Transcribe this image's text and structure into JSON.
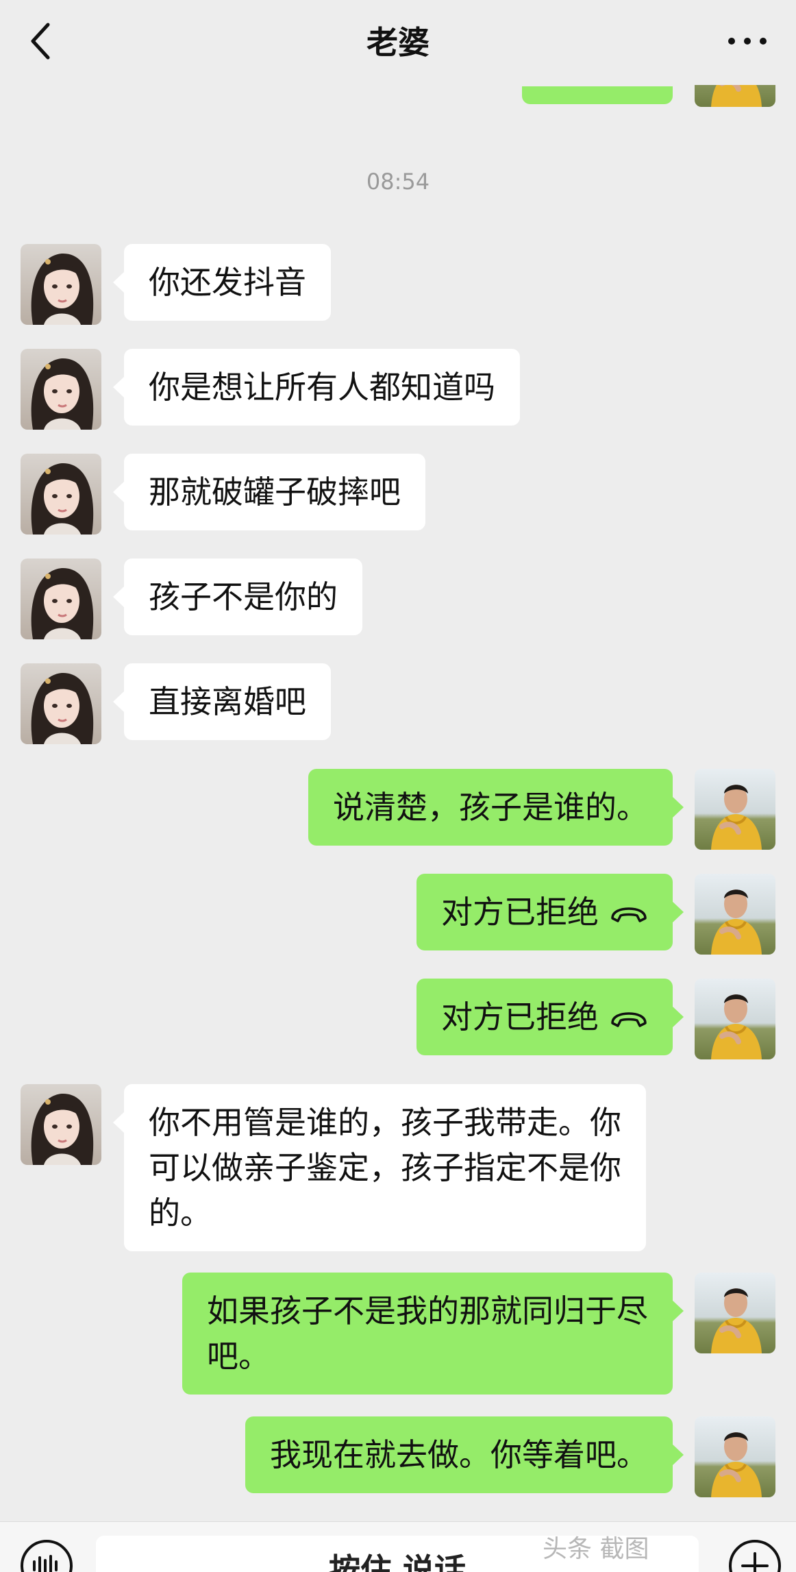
{
  "header": {
    "title": "老婆"
  },
  "timestamp": "08:54",
  "messages": [
    {
      "side": "in",
      "text": "你还发抖音"
    },
    {
      "side": "in",
      "text": "你是想让所有人都知道吗"
    },
    {
      "side": "in",
      "text": "那就破罐子破摔吧"
    },
    {
      "side": "in",
      "text": "孩子不是你的"
    },
    {
      "side": "in",
      "text": "直接离婚吧"
    },
    {
      "side": "out",
      "text": "说清楚，孩子是谁的。"
    },
    {
      "side": "out",
      "text": "对方已拒绝",
      "icon": "declined-call-icon"
    },
    {
      "side": "out",
      "text": "对方已拒绝",
      "icon": "declined-call-icon"
    },
    {
      "side": "in",
      "text": "你不用管是谁的，孩子我带走。你\n可以做亲子鉴定，孩子指定不是你\n的。"
    },
    {
      "side": "out",
      "text": "如果孩子不是我的那就同归于尽\n吧。"
    },
    {
      "side": "out",
      "text": "我现在就去做。你等着吧。"
    }
  ],
  "input_bar": {
    "hold_to_talk": "按住 说话",
    "watermark": "头条 截图"
  },
  "colors": {
    "background": "#ededed",
    "outgoing_bubble": "#95ec69",
    "incoming_bubble": "#ffffff",
    "timestamp": "#9a9a9a"
  }
}
